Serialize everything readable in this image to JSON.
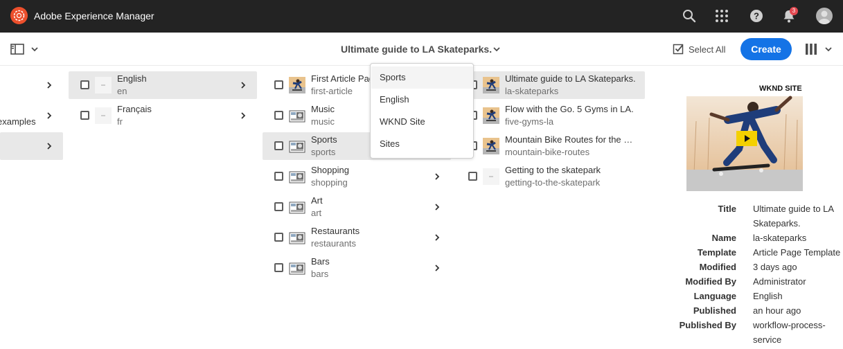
{
  "header": {
    "app_title": "Adobe Experience Manager",
    "notification_count": "3",
    "icons": [
      "adobe-experience-cloud-icon",
      "search-icon",
      "apps-grid-icon",
      "help-icon",
      "bell-icon",
      "user-avatar"
    ]
  },
  "actionbar": {
    "page_title": "Ultimate guide to LA Skateparks.",
    "select_all_label": "Select All",
    "create_label": "Create",
    "colors": {
      "create": "#1473e6"
    }
  },
  "breadcrumb_dropdown": {
    "items": [
      "Sports",
      "English",
      "WKND Site",
      "Sites"
    ]
  },
  "column0": {
    "items": [
      {
        "title": "examples"
      }
    ]
  },
  "column1": {
    "items": [
      {
        "title": "English",
        "name": "en"
      },
      {
        "title": "Français",
        "name": "fr"
      }
    ]
  },
  "column2": {
    "items": [
      {
        "title": "First Article Page",
        "name": "first-article"
      },
      {
        "title": "Music",
        "name": "music"
      },
      {
        "title": "Sports",
        "name": "sports"
      },
      {
        "title": "Shopping",
        "name": "shopping"
      },
      {
        "title": "Art",
        "name": "art"
      },
      {
        "title": "Restaurants",
        "name": "restaurants"
      },
      {
        "title": "Bars",
        "name": "bars"
      }
    ]
  },
  "column3": {
    "items": [
      {
        "title": "Ultimate guide to LA Skateparks.",
        "name": "la-skateparks"
      },
      {
        "title": "Flow with the Go. 5 Gyms in LA.",
        "name": "five-gyms-la"
      },
      {
        "title": "Mountain Bike Routes for the …",
        "name": "mountain-bike-routes"
      },
      {
        "title": "Getting to the skatepark",
        "name": "getting-to-the-skatepark"
      }
    ]
  },
  "preview": {
    "brand": "WKND SITE",
    "meta": [
      {
        "label": "Title",
        "value": "Ultimate guide to LA Skateparks."
      },
      {
        "label": "Name",
        "value": "la-skateparks"
      },
      {
        "label": "Template",
        "value": "Article Page Template"
      },
      {
        "label": "Modified",
        "value": "3 days ago"
      },
      {
        "label": "Modified By",
        "value": "Administrator"
      },
      {
        "label": "Language",
        "value": "English"
      },
      {
        "label": "Published",
        "value": "an hour ago"
      },
      {
        "label": "Published By",
        "value": "workflow-process-service"
      }
    ]
  }
}
